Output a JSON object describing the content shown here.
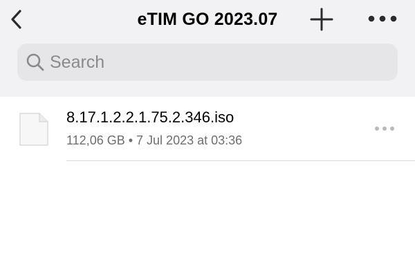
{
  "nav": {
    "title": "eTIM GO 2023.07",
    "back_icon": "chevron-left-icon",
    "add_icon": "plus-icon",
    "more_icon": "ellipsis-icon"
  },
  "search": {
    "placeholder": "Search",
    "icon": "search-icon"
  },
  "files": [
    {
      "name": "8.17.1.2.2.1.75.2.346.iso",
      "size": "112,06 GB",
      "date": "7 Jul 2023 at 03:36",
      "meta": "112,06 GB • 7 Jul 2023 at 03:36",
      "icon": "document-icon"
    }
  ],
  "colors": {
    "header_bg": "#f2f2f4",
    "search_bg": "#e6e6e9",
    "secondary_text": "#6e6e73"
  }
}
